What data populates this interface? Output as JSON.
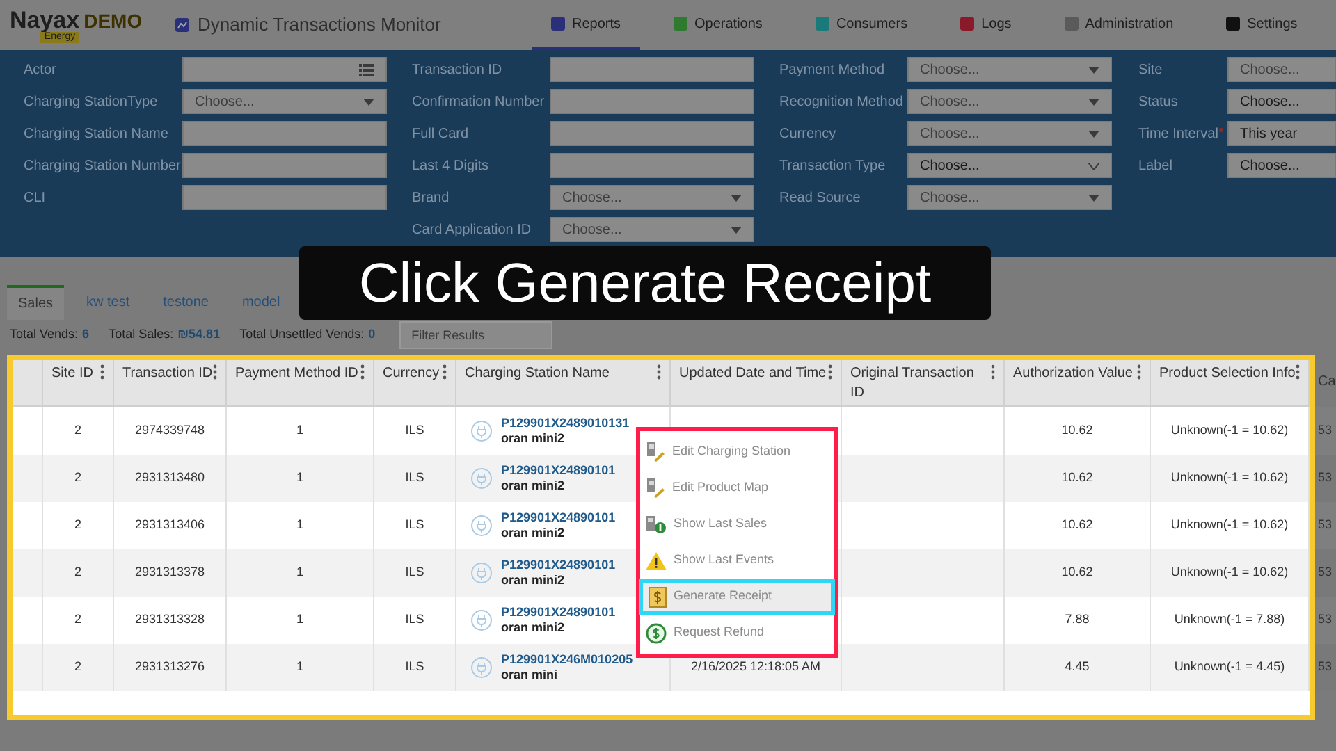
{
  "header": {
    "logo": "Nayax",
    "logo_suffix": "DEMO",
    "logo_badge": "Energy",
    "title": "Dynamic Transactions Monitor",
    "nav": [
      {
        "label": "Reports",
        "selected": true,
        "color": "#2b2f7a"
      },
      {
        "label": "Operations",
        "selected": false,
        "color": "#2e7a2e"
      },
      {
        "label": "Consumers",
        "selected": false,
        "color": "#1a7a7a"
      },
      {
        "label": "Logs",
        "selected": false,
        "color": "#8a1a2a"
      },
      {
        "label": "Administration",
        "selected": false,
        "color": "#5a5a5a"
      },
      {
        "label": "Settings",
        "selected": false,
        "color": "#111111"
      }
    ]
  },
  "filters": [
    [
      {
        "label": "Actor",
        "kind": "list"
      },
      {
        "label": "Charging StationType",
        "kind": "select",
        "placeholder": "Choose..."
      },
      {
        "label": "Charging Station Name",
        "kind": "text"
      },
      {
        "label": "Charging Station Number",
        "kind": "text"
      },
      {
        "label": "CLI",
        "kind": "text"
      }
    ],
    [
      {
        "label": "Transaction ID",
        "kind": "text"
      },
      {
        "label": "Confirmation Number",
        "kind": "text"
      },
      {
        "label": "Full Card",
        "kind": "text"
      },
      {
        "label": "Last 4 Digits",
        "kind": "text"
      },
      {
        "label": "Brand",
        "kind": "select",
        "placeholder": "Choose..."
      },
      {
        "label": "Card Application ID",
        "kind": "select",
        "placeholder": "Choose..."
      }
    ],
    [
      {
        "label": "Payment Method",
        "kind": "select",
        "placeholder": "Choose..."
      },
      {
        "label": "Recognition Method",
        "kind": "select",
        "placeholder": "Choose..."
      },
      {
        "label": "Currency",
        "kind": "select",
        "placeholder": "Choose..."
      },
      {
        "label": "Transaction Type",
        "kind": "select",
        "value": "Choose..."
      },
      {
        "label": "Read Source",
        "kind": "select",
        "placeholder": "Choose..."
      }
    ],
    [
      {
        "label": "Site",
        "kind": "plain",
        "placeholder": "Choose..."
      },
      {
        "label": "Status",
        "kind": "plain",
        "value": "Choose..."
      },
      {
        "label": "Time Interval",
        "kind": "plain",
        "value": "This year",
        "required": true
      },
      {
        "label": "Label",
        "kind": "plain",
        "value": "Choose..."
      }
    ]
  ],
  "report_tabs": [
    {
      "label": "Sales",
      "selected": true
    },
    {
      "label": "kw test",
      "selected": false
    },
    {
      "label": "testone",
      "selected": false
    },
    {
      "label": "model",
      "selected": false
    }
  ],
  "totals": [
    {
      "label": "Total Vends:",
      "value": "6"
    },
    {
      "label": "Total Sales:",
      "value": "₪54.81"
    },
    {
      "label": "Total Unsettled Vends:",
      "value": "0"
    }
  ],
  "filter_results": {
    "placeholder": "Filter Results"
  },
  "table": {
    "columns": [
      "Site ID",
      "Transaction ID",
      "Payment Method ID",
      "Currency",
      "Charging Station Name",
      "Updated Date and Time",
      "Original Transaction ID",
      "Authorization Value",
      "Product Selection Info",
      "Ca"
    ],
    "rows": [
      {
        "site": "2",
        "transaction": "2974339748",
        "payment": "1",
        "currency": "ILS",
        "station": "P129901X2489010131",
        "station_name": "oran mini2",
        "auth": "10.62",
        "product": "Unknown(-1 = 10.62)",
        "column_11": "53"
      },
      {
        "site": "2",
        "transaction": "2931313480",
        "payment": "1",
        "currency": "ILS",
        "station": "P129901X24890101",
        "station_name": "oran mini2",
        "auth": "10.62",
        "product": "Unknown(-1 = 10.62)",
        "column_11": "53"
      },
      {
        "site": "2",
        "transaction": "2931313406",
        "payment": "1",
        "currency": "ILS",
        "station": "P129901X24890101",
        "station_name": "oran mini2",
        "auth": "10.62",
        "product": "Unknown(-1 = 10.62)",
        "column_11": "53"
      },
      {
        "site": "2",
        "transaction": "2931313378",
        "payment": "1",
        "currency": "ILS",
        "station": "P129901X24890101",
        "station_name": "oran mini2",
        "auth": "10.62",
        "product": "Unknown(-1 = 10.62)",
        "column_11": "53"
      },
      {
        "site": "2",
        "transaction": "2931313328",
        "payment": "1",
        "currency": "ILS",
        "station": "P129901X24890101",
        "station_name": "oran mini2",
        "auth": "7.88",
        "product": "Unknown(-1 = 7.88)",
        "column_11": "53"
      },
      {
        "site": "2",
        "transaction": "2931313276",
        "payment": "1",
        "currency": "ILS",
        "station": "P129901X246M010205",
        "station_name": "oran mini",
        "updated": "2/16/2025 12:18:05 AM",
        "auth": "4.45",
        "product": "Unknown(-1 = 4.45)",
        "column_11": "53"
      }
    ]
  },
  "context_menu": [
    {
      "label": "Edit Charging Station",
      "selected": false
    },
    {
      "label": "Edit Product Map",
      "selected": false
    },
    {
      "label": "Show Last Sales",
      "selected": false
    },
    {
      "label": "Show Last Events",
      "selected": false
    },
    {
      "label": "Generate Receipt",
      "selected": true
    },
    {
      "label": "Request Refund",
      "selected": false
    }
  ],
  "caption": "Click Generate Receipt"
}
